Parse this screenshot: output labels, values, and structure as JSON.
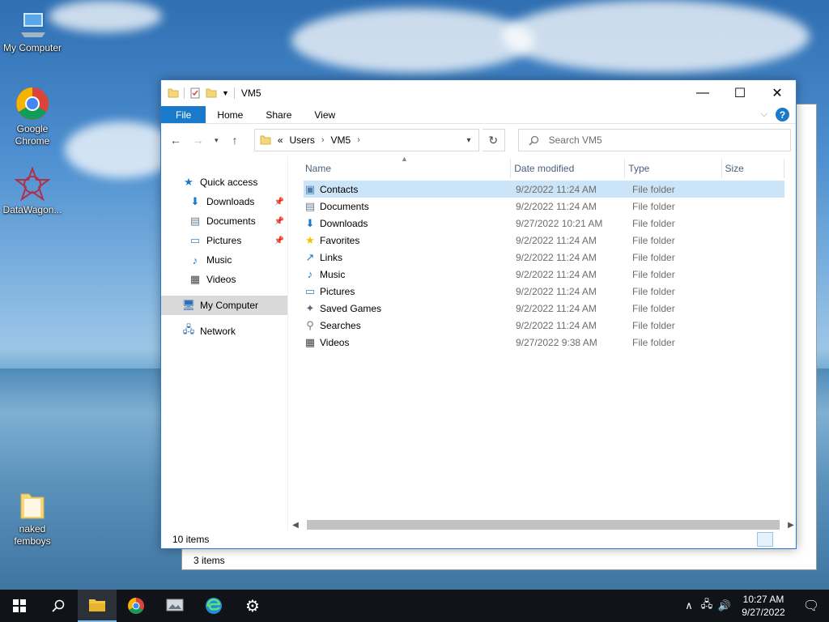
{
  "desktop": {
    "icons": [
      {
        "label": "My Computer"
      },
      {
        "label": "Google Chrome"
      },
      {
        "label": "DataWagon..."
      },
      {
        "label": "naked femboys"
      }
    ]
  },
  "back_window": {
    "status": "3 items"
  },
  "window": {
    "title": "VM5",
    "ribbon_tabs": {
      "file": "File",
      "home": "Home",
      "share": "Share",
      "view": "View"
    },
    "help": "?",
    "breadcrumb": {
      "overflow": "«",
      "items": [
        "Users",
        "VM5"
      ]
    },
    "search": {
      "placeholder": "Search VM5"
    },
    "nav": {
      "quick_access": "Quick access",
      "quick_items": [
        "Downloads",
        "Documents",
        "Pictures",
        "Music",
        "Videos"
      ],
      "my_computer": "My Computer",
      "network": "Network"
    },
    "columns": {
      "name": "Name",
      "date": "Date modified",
      "type": "Type",
      "size": "Size"
    },
    "files": [
      {
        "name": "Contacts",
        "date": "9/2/2022 11:24 AM",
        "type": "File folder",
        "icon": "contacts-icon"
      },
      {
        "name": "Documents",
        "date": "9/2/2022 11:24 AM",
        "type": "File folder",
        "icon": "documents-icon"
      },
      {
        "name": "Downloads",
        "date": "9/27/2022 10:21 AM",
        "type": "File folder",
        "icon": "downloads-icon"
      },
      {
        "name": "Favorites",
        "date": "9/2/2022 11:24 AM",
        "type": "File folder",
        "icon": "star-icon"
      },
      {
        "name": "Links",
        "date": "9/2/2022 11:24 AM",
        "type": "File folder",
        "icon": "link-icon"
      },
      {
        "name": "Music",
        "date": "9/2/2022 11:24 AM",
        "type": "File folder",
        "icon": "music-icon"
      },
      {
        "name": "Pictures",
        "date": "9/2/2022 11:24 AM",
        "type": "File folder",
        "icon": "pictures-icon"
      },
      {
        "name": "Saved Games",
        "date": "9/2/2022 11:24 AM",
        "type": "File folder",
        "icon": "games-icon"
      },
      {
        "name": "Searches",
        "date": "9/2/2022 11:24 AM",
        "type": "File folder",
        "icon": "search-icon"
      },
      {
        "name": "Videos",
        "date": "9/27/2022 9:38 AM",
        "type": "File folder",
        "icon": "videos-icon"
      }
    ],
    "status": "10 items",
    "accent_color": "#1979ca"
  },
  "taskbar": {
    "time": "10:27 AM",
    "date": "9/27/2022"
  }
}
